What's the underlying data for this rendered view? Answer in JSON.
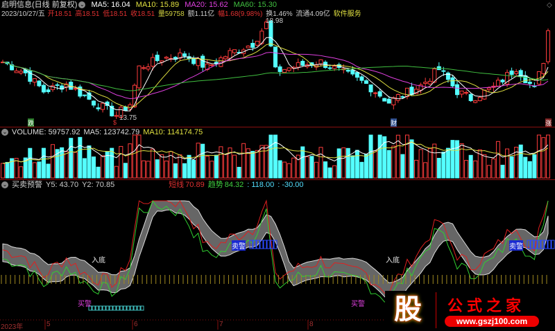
{
  "header": {
    "title": "启明信息(日线 前复权)",
    "ma5": "MA5: 16.04",
    "ma10": "MA10: 15.89",
    "ma20": "MA20: 15.62",
    "ma60": "MA60: 15.30",
    "date": "2023/10/27/五",
    "open": "开18.51",
    "high": "高18.51",
    "low": "低18.51",
    "close": "收18.51",
    "volume": "量59758",
    "amount": "额1.11亿",
    "change": "幅1.68(9.98%)",
    "turnover": "换1.46%",
    "float": "流通4.09亿",
    "sector": "软件服务"
  },
  "price_chart": {
    "max_label": "18.98",
    "min_label": "13.75",
    "markers": [
      "跌",
      "$",
      "财",
      "涨"
    ],
    "keypoints": [
      [
        0,
        16.8
      ],
      [
        5,
        16.2
      ],
      [
        9,
        15.2
      ],
      [
        14,
        15.6
      ],
      [
        20,
        14.6
      ],
      [
        25,
        13.9
      ],
      [
        28,
        14.5
      ],
      [
        30,
        16.5
      ],
      [
        35,
        17.0
      ],
      [
        40,
        17.2
      ],
      [
        45,
        16.5
      ],
      [
        50,
        17.3
      ],
      [
        55,
        17.8
      ],
      [
        58,
        18.9
      ],
      [
        60,
        16.3
      ],
      [
        65,
        16.6
      ],
      [
        70,
        16.8
      ],
      [
        75,
        16.2
      ],
      [
        80,
        15.6
      ],
      [
        85,
        14.6
      ],
      [
        87,
        14.9
      ],
      [
        92,
        15.5
      ],
      [
        96,
        16.4
      ],
      [
        100,
        15.2
      ],
      [
        103,
        14.8
      ],
      [
        108,
        15.4
      ],
      [
        113,
        16.5
      ],
      [
        117,
        15.3
      ],
      [
        119,
        16.9
      ],
      [
        120,
        18.51
      ]
    ]
  },
  "volume_panel": {
    "title": "VOLUME: 59757.92",
    "ma5": "MA5: 123742.79",
    "ma10": "MA10: 114174.75"
  },
  "indicator_panel": {
    "title": "买卖预警",
    "y5": "Y5: 43.70",
    "y2": "Y2: 70.85",
    "short_label": "短线",
    "short_value": "70.89",
    "trend_label": "趋势",
    "trend_value": "84.32",
    "v1": ": 118.00",
    "v2": ": -30.00",
    "bottom_labels": [
      "入底",
      "入底"
    ],
    "sell_labels": [
      "卖警",
      "卖警"
    ],
    "buy_labels": [
      "买警",
      "买警"
    ]
  },
  "xaxis": [
    "2023年",
    "5",
    "6",
    "7",
    "8"
  ],
  "watermark": {
    "logo_char": "股",
    "name": "公式之家",
    "url": "www.gszj100.com"
  },
  "colors": {
    "up": "#ff3c3c",
    "down": "#54ffff",
    "ma5": "#ffffff",
    "ma10": "#e0e040",
    "ma20": "#e040e0",
    "ma60": "#40c040"
  }
}
